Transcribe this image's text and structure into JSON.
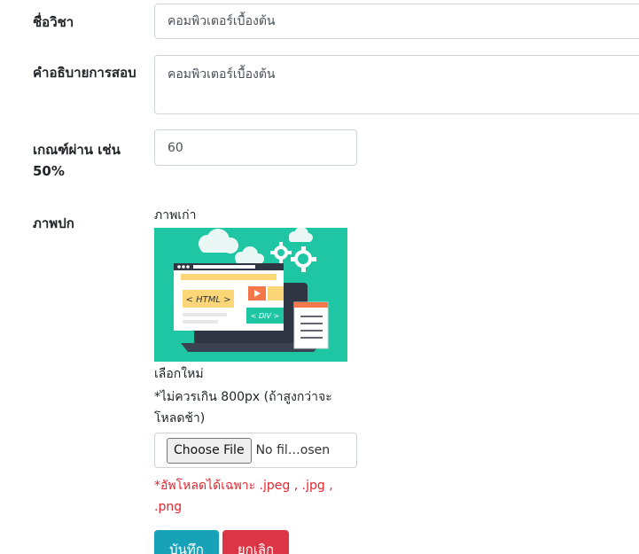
{
  "form": {
    "course_name": {
      "label": "ชื่อวิชา",
      "value": "คอมพิวเตอร์เบื้องต้น"
    },
    "description": {
      "label": "คำอธิบายการสอบ",
      "value": "คอมพิวเตอร์เบื้องต้น"
    },
    "pass_criteria": {
      "label_line1": "เกณฑ์ผ่าน เช่น",
      "label_line2": "50%",
      "value": "60"
    },
    "cover": {
      "label": "ภาพปก",
      "old_image_caption": "ภาพเก่า",
      "image_text_html": "< HTML >",
      "image_text_div": "< DIV >",
      "new_image_caption": "เลือกใหม่",
      "hint_line1": "*ไม่ควรเกิน 800px (ถ้าสูงกว่าจะ",
      "hint_line2": "โหลดช้า)",
      "choose_file_label": "Choose File",
      "file_status": "No fil…osen",
      "error_line1": "*อัพโหลดได้เฉพาะ .jpeg , .jpg ,",
      "error_line2": ".png"
    }
  },
  "actions": {
    "save_label": "บันทึก",
    "cancel_label": "ยกเลิก"
  },
  "colors": {
    "save": "#17a2b8",
    "cancel": "#dc3545",
    "error": "#e3262f",
    "image_bg": "#1fc6a4"
  }
}
